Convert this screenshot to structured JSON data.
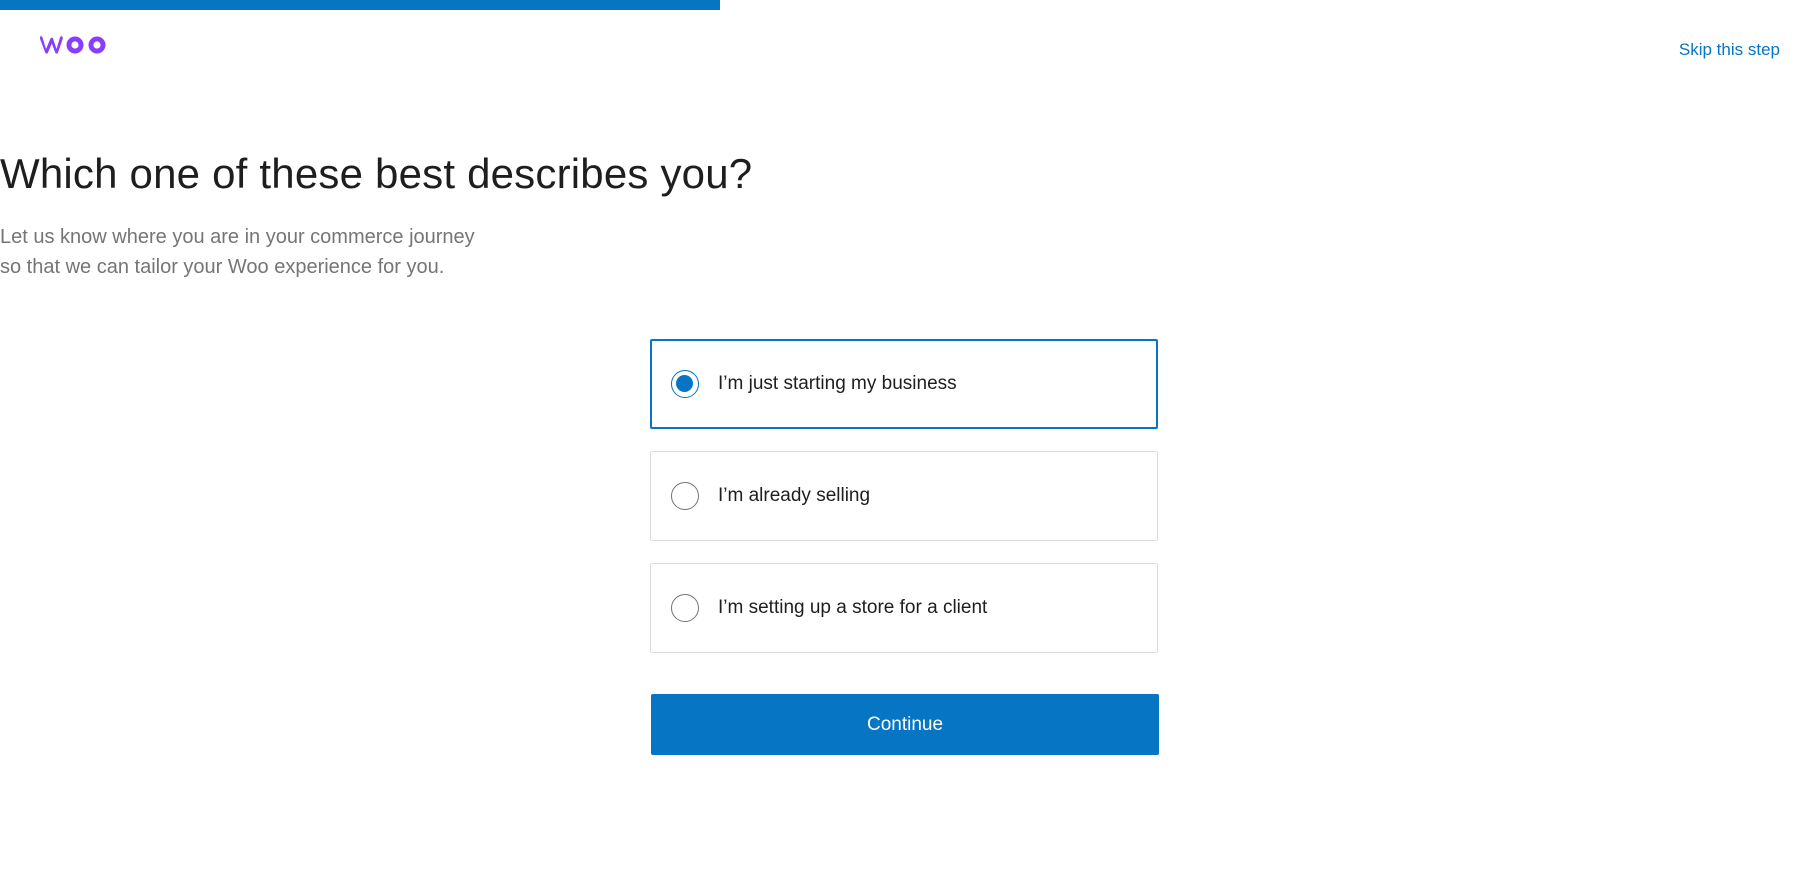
{
  "progress": {
    "percent": 40
  },
  "brand": {
    "logo_text": "woo",
    "color": "#873eff"
  },
  "header": {
    "skip_label": "Skip this step"
  },
  "main": {
    "title": "Which one of these best describes you?",
    "subtitle_line1": "Let us know where you are in your commerce journey",
    "subtitle_line2": "so that we can tailor your Woo experience for you.",
    "options": [
      {
        "label": "I’m just starting my business",
        "selected": true
      },
      {
        "label": "I’m already selling",
        "selected": false
      },
      {
        "label": "I’m setting up a store for a client",
        "selected": false
      }
    ],
    "continue_label": "Continue"
  },
  "colors": {
    "accent": "#0675c4",
    "text": "#1e1e1e",
    "muted": "#757575"
  }
}
